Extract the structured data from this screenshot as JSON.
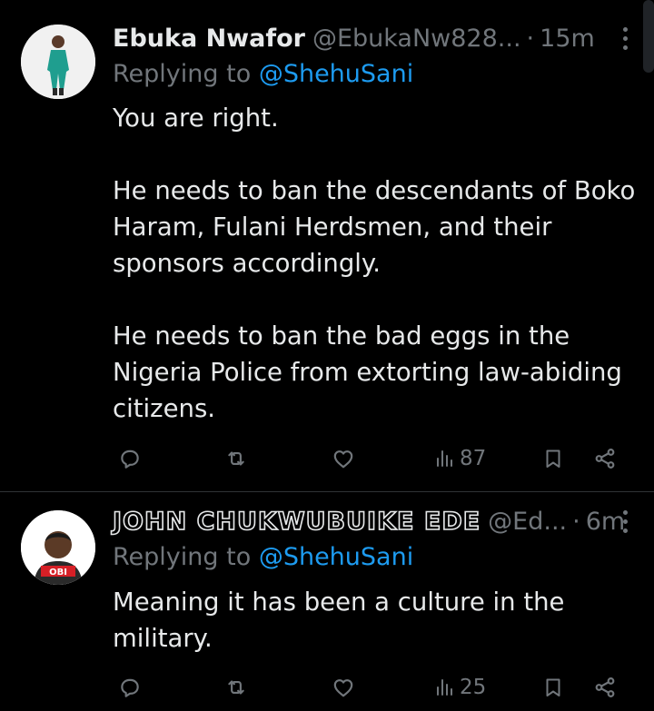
{
  "tweets": [
    {
      "author_name": "Ebuka Nwafor",
      "handle": "@EbukaNw828...",
      "separator": "·",
      "time": "15m",
      "replying_prefix": "Replying to ",
      "replying_to": "@ShehuSani",
      "paragraphs": [
        "You are right.",
        "He needs to ban the descendants of Boko Haram, Fulani Herdsmen, and their sponsors accordingly.",
        "He needs to ban the bad eggs in the Nigeria Police from extorting law-abiding citizens."
      ],
      "views": "87",
      "avatar_icon": "man-in-green-outfit-photo"
    },
    {
      "author_name": "JOHN CHUKWUBUIKE EDE",
      "handle": "@Ed...",
      "separator": "·",
      "time": "6m",
      "replying_prefix": "Replying to ",
      "replying_to": "@ShehuSani",
      "paragraphs": [
        "Meaning it has been a culture in the military."
      ],
      "views": "25",
      "avatar_icon": "obi-campaign-photo",
      "avatar_badge": "OBI"
    }
  ],
  "colors": {
    "background": "#000000",
    "text": "#e7e9ea",
    "secondary": "#71767b",
    "mention": "#1d9bf0",
    "divider": "#2f3336"
  }
}
